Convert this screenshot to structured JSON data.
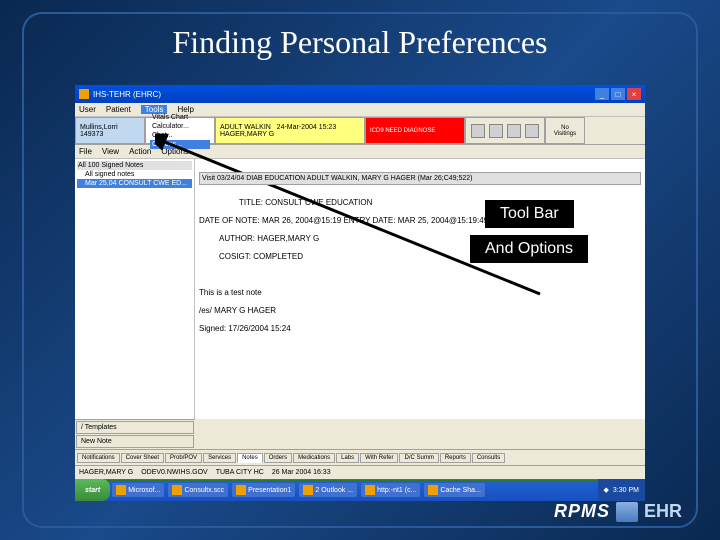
{
  "slide_title": "Finding Personal Preferences",
  "callouts": {
    "toolbar": "Tool Bar",
    "options": "And Options"
  },
  "window": {
    "title": "IHS-TEHR (EHRC)",
    "menu": [
      "User",
      "Patient",
      "Tools",
      "Help"
    ],
    "active_menu": "Tools",
    "dropdown": [
      "Vitals Chart",
      "Calculator...",
      "Chat...",
      "Options..."
    ],
    "dropdown_sel": "Options...",
    "patient": {
      "name": "Mullins,Lorri",
      "id": "149373"
    },
    "visit": {
      "type": "ADULT WALKIN",
      "dt": "24-Mar-2004 15:23",
      "prov": "HAGER,MARY G"
    },
    "alert": "ICD9 NEED DIAGNOSE",
    "nv": "No\nVisitings",
    "submenu": [
      "File",
      "View",
      "Action",
      "Options"
    ],
    "vhdr": "Visit 03/24/04 DIAB EDUCATION ADULT WALKIN, MARY G HAGER (Mar 26;C49;522)",
    "tree_top": "All 100 Signed Notes",
    "tree_items": [
      "All signed notes",
      "Mar 25,04 CONSULT CWE ED..."
    ],
    "note": {
      "title": "TITLE: CONSULT CWE EDUCATION",
      "date": "DATE OF NOTE: MAR 26, 2004@15:19    ENTRY DATE: MAR 25, 2004@15:19:49",
      "author": "AUTHOR: HAGER,MARY G",
      "cos": "COSIGT:                          COMPLETED",
      "body": "This is a test note\n\n/es/ MARY G HAGER\n\nSigned: 17/26/2004 15:24"
    },
    "left_buttons": [
      "/ Templates",
      "New Note"
    ],
    "tabs": [
      "Notifications",
      "Cover Sheet",
      "Prob/POV",
      "Services",
      "Notes",
      "Orders",
      "Medications",
      "Labs",
      "With Refer",
      "D/C Summ",
      "Reports",
      "Consults"
    ],
    "active_tab": "Notes",
    "status": [
      "HAGER,MARY G",
      "ODEV0.NWIHS.GOV",
      "TUBA CITY HC",
      "26 Mar 2004 16:33"
    ]
  },
  "taskbar": {
    "start": "start",
    "tasks": [
      "Microsof...",
      "Consultx.scc",
      "Presentation1",
      "2 Outlook ...",
      "http:-nt1 (c...",
      "Cache Sha..."
    ],
    "time": "3:30 PM"
  },
  "logo": {
    "r": "RPMS",
    "e": "EHR"
  }
}
